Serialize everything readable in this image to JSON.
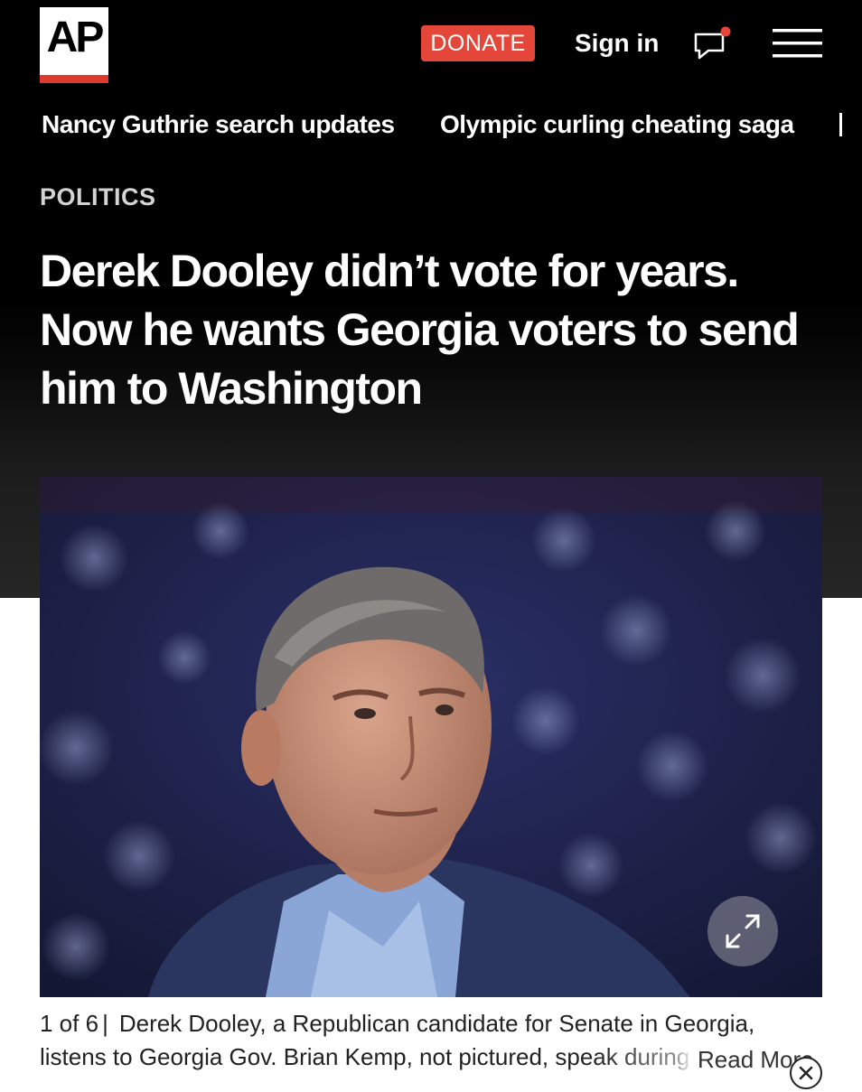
{
  "header": {
    "logo_text": "AP",
    "donate_label": "DONATE",
    "signin_label": "Sign in",
    "brand_red": "#e03a2f",
    "donate_color": "#e4473a"
  },
  "trending": [
    {
      "label": "Nancy Guthrie search updates"
    },
    {
      "label": "Olympic curling cheating saga"
    }
  ],
  "article": {
    "section": "POLITICS",
    "headline": "Derek Dooley didn’t vote for years. Now he wants Georgia voters to send him to Washington"
  },
  "gallery": {
    "counter": "1 of 6",
    "separator": "|",
    "caption_main": "Derek Dooley, a Republican candidate for Senate in Georgia, listens to Georgia Gov. Brian Kemp, not pictured,",
    "caption_faded": "speak during an At",
    "read_more": "Read More"
  },
  "icons": [
    "chat-bubble-icon",
    "hamburger-menu-icon",
    "expand-icon",
    "close-icon"
  ]
}
